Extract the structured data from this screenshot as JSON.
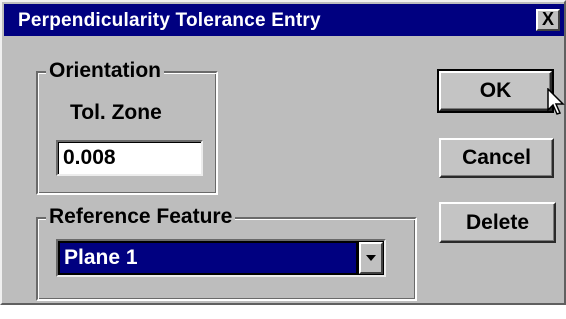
{
  "window": {
    "title": "Perpendicularity Tolerance Entry",
    "close_label": "X"
  },
  "orientation": {
    "legend": "Orientation",
    "tol_zone_label": "Tol. Zone",
    "tol_zone_value": "0.008"
  },
  "reference": {
    "legend": "Reference Feature",
    "selected": "Plane 1"
  },
  "buttons": {
    "ok": "OK",
    "cancel": "Cancel",
    "delete": "Delete"
  },
  "icons": {
    "close": "close-icon",
    "dropdown": "chevron-down-icon",
    "cursor": "mouse-pointer-icon"
  },
  "colors": {
    "titlebar": "#000080",
    "dialog_face": "#bdbdbd",
    "selection": "#000080"
  }
}
